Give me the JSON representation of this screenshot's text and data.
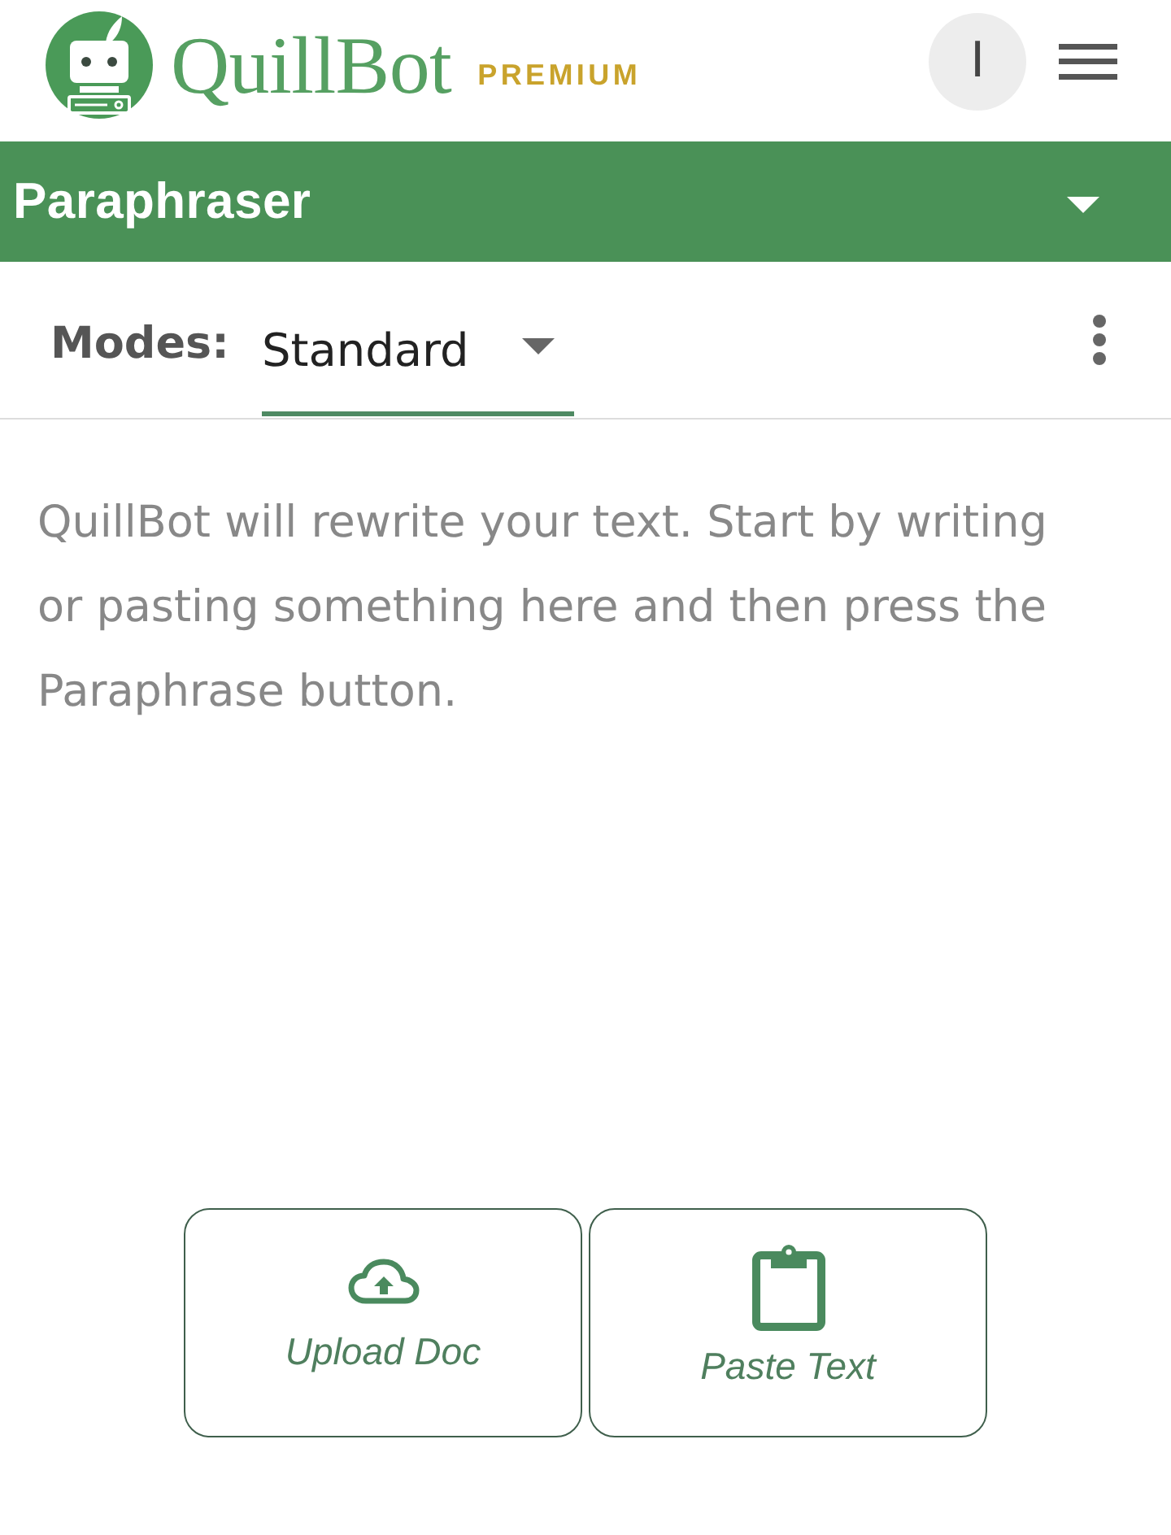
{
  "header": {
    "brand": "QuillBot",
    "plan": "PREMIUM",
    "avatar_initial": "I"
  },
  "tool_bar": {
    "title": "Paraphraser"
  },
  "modes": {
    "label": "Modes:",
    "current": "Standard"
  },
  "editor": {
    "placeholder": "QuillBot will rewrite your text. Start by writing or pasting something here and then press the Paraphrase button."
  },
  "actions": [
    {
      "kind": "upload",
      "label": "Upload Doc"
    },
    {
      "kind": "paste",
      "label": "Paste Text"
    }
  ]
}
